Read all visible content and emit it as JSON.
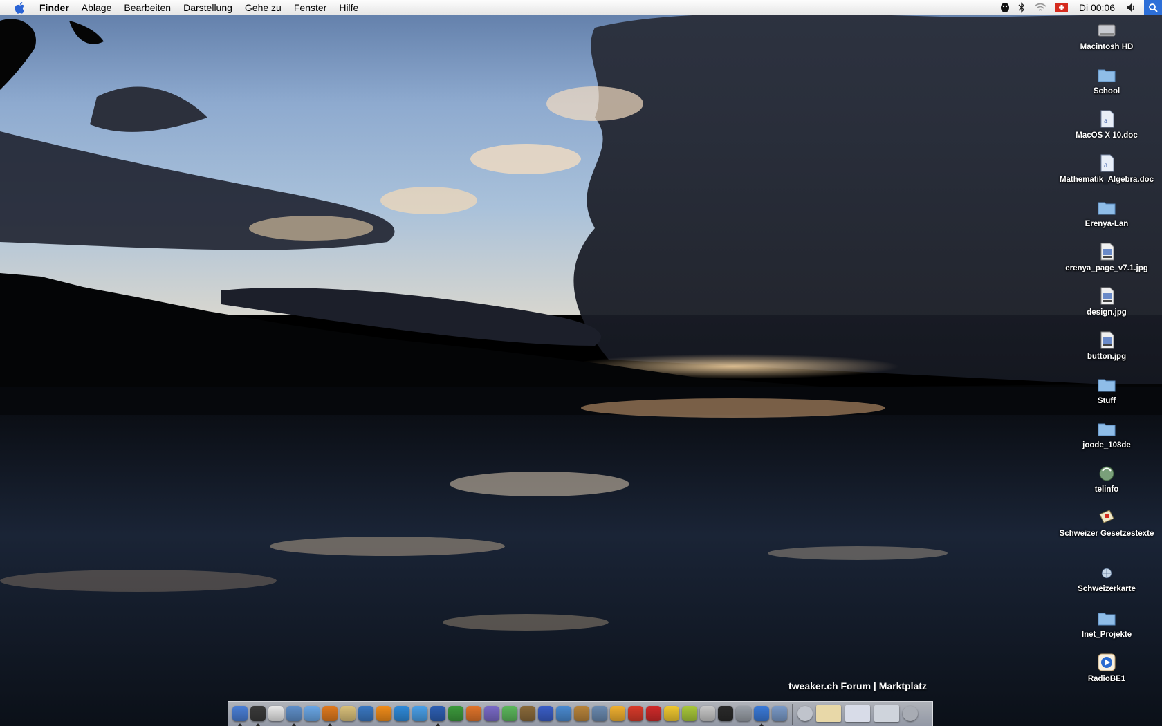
{
  "menubar": {
    "apple_icon": "apple-icon",
    "items": [
      "Finder",
      "Ablage",
      "Bearbeiten",
      "Darstellung",
      "Gehe zu",
      "Fenster",
      "Hilfe"
    ],
    "clock": "Di 00:06",
    "extras": [
      "status-app-icon",
      "bluetooth-icon",
      "wifi-icon",
      "swiss-flag-icon",
      "volume-icon",
      "spotlight-icon"
    ]
  },
  "desktop": {
    "icons": [
      {
        "label": "Macintosh HD",
        "type": "drive"
      },
      {
        "label": "School",
        "type": "folder"
      },
      {
        "label": "MacOS X 10.doc",
        "type": "doc"
      },
      {
        "label": "Mathematik_Algebra.doc",
        "type": "doc"
      },
      {
        "label": "Erenya-Lan",
        "type": "folder"
      },
      {
        "label": "erenya_page_v7.1.jpg",
        "type": "jpeg"
      },
      {
        "label": "design.jpg",
        "type": "jpeg"
      },
      {
        "label": "button.jpg",
        "type": "jpeg"
      },
      {
        "label": "Stuff",
        "type": "folder"
      },
      {
        "label": "joode_108de",
        "type": "folder"
      },
      {
        "label": "telinfo",
        "type": "app"
      },
      {
        "label": "Schweizer Gesetzestexte",
        "type": "app"
      },
      {
        "label": "Schweizerkarte",
        "type": "app"
      },
      {
        "label": "Inet_Projekte",
        "type": "folder"
      },
      {
        "label": "RadioBE1",
        "type": "app"
      }
    ]
  },
  "widget": {
    "text": "tweaker.ch Forum | Marktplatz"
  },
  "dock": {
    "apps": [
      {
        "icon": "finder-icon",
        "color": "#4a7fd6",
        "running": true
      },
      {
        "icon": "dashboard-icon",
        "color": "#3a3a3a",
        "running": true
      },
      {
        "icon": "ical-icon",
        "color": "#e8e8e8",
        "running": false
      },
      {
        "icon": "preview-icon",
        "color": "#5f8fc9",
        "running": true
      },
      {
        "icon": "safari-icon",
        "color": "#6aa7e6",
        "running": false
      },
      {
        "icon": "firefox-icon",
        "color": "#e07a1f",
        "running": true
      },
      {
        "icon": "notes-icon",
        "color": "#d9c07a",
        "running": false
      },
      {
        "icon": "thunderbird-icon",
        "color": "#3a78c2",
        "running": false
      },
      {
        "icon": "vlc-icon",
        "color": "#f08c1a",
        "running": false
      },
      {
        "icon": "camino-icon",
        "color": "#2f8ad9",
        "running": false
      },
      {
        "icon": "ichat-icon",
        "color": "#4aa0e8",
        "running": false
      },
      {
        "icon": "word-icon",
        "color": "#2d5fb3",
        "running": true
      },
      {
        "icon": "excel-icon",
        "color": "#3c9a3c",
        "running": false
      },
      {
        "icon": "powerpoint-icon",
        "color": "#e0742a",
        "running": false
      },
      {
        "icon": "entourage-icon",
        "color": "#7a6ac7",
        "running": false
      },
      {
        "icon": "itunes-icon",
        "color": "#5cb85c",
        "running": false
      },
      {
        "icon": "iphoto-icon",
        "color": "#8a6a3a",
        "running": false
      },
      {
        "icon": "imovie-icon",
        "color": "#3a5ec7",
        "running": false
      },
      {
        "icon": "idvd-icon",
        "color": "#4a8ad0",
        "running": false
      },
      {
        "icon": "garageband-icon",
        "color": "#b8843a",
        "running": false
      },
      {
        "icon": "utility-icon",
        "color": "#6a8ab0",
        "running": false
      },
      {
        "icon": "adium-icon",
        "color": "#f0b030",
        "running": false
      },
      {
        "icon": "flash-icon",
        "color": "#d83a2a",
        "running": false
      },
      {
        "icon": "strawberry-icon",
        "color": "#d02a2a",
        "running": false
      },
      {
        "icon": "cyberduck-icon",
        "color": "#f0c830",
        "running": false
      },
      {
        "icon": "camera-icon",
        "color": "#a8c83a",
        "running": false
      },
      {
        "icon": "teapot-icon",
        "color": "#c8c8c8",
        "running": false
      },
      {
        "icon": "terminal-icon",
        "color": "#2a2a2a",
        "running": false
      },
      {
        "icon": "system-preferences-icon",
        "color": "#9aa0a8",
        "running": false
      },
      {
        "icon": "quicktime-icon",
        "color": "#3a7ad8",
        "running": true
      },
      {
        "icon": "mail-icon",
        "color": "#7a9ac8",
        "running": false
      }
    ],
    "docs": [
      {
        "icon": "cd-icon",
        "color": "#c0c4cc"
      },
      {
        "icon": "minimized-window-1-icon",
        "color": "#e8d8a8"
      },
      {
        "icon": "minimized-window-2-icon",
        "color": "#d8dce8"
      },
      {
        "icon": "minimized-window-3-icon",
        "color": "#cfd4dc"
      },
      {
        "icon": "trash-icon",
        "color": "#a8acb4"
      }
    ]
  }
}
